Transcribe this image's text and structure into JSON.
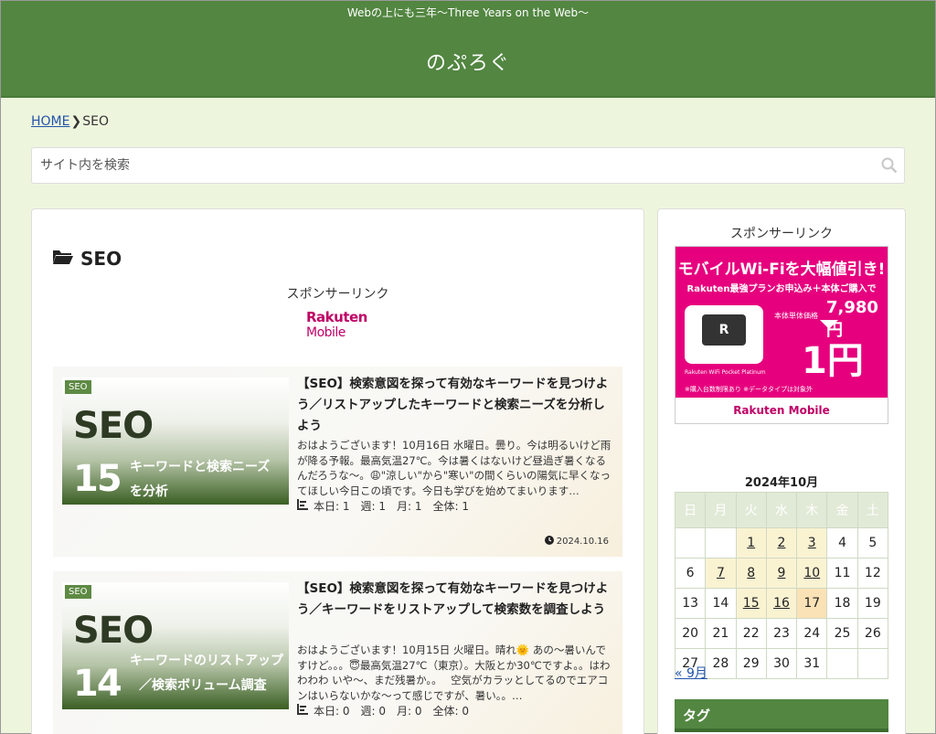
{
  "site": {
    "tagline": "Webの上にも三年〜Three Years on the Web〜",
    "title": "のぷろぐ"
  },
  "breadcrumb": {
    "home": "HOME",
    "current": "SEO"
  },
  "search": {
    "placeholder": "サイト内を検索"
  },
  "category": {
    "title": "SEO"
  },
  "sponsor_label": "スポンサーリンク",
  "rakuten_logo": {
    "line1": "Rakuten",
    "line2": "Mobile"
  },
  "posts": [
    {
      "badge": "SEO",
      "thumb_big": "SEO",
      "thumb_num": "15",
      "thumb_line1": "キーワードと検索ニーズ",
      "thumb_line2": "を分析",
      "title": "【SEO】検索意図を探って有効なキーワードを見つけよう／リストアップしたキーワードと検索ニーズを分析しよう",
      "excerpt": "おはようございます！10月16日 水曜日。曇り。今は明るいけど雨が降る予報。最高気温27℃。今は暑くはないけど昼過ぎ暑くなるんだろうな〜。😩\"涼しい\"から\"寒い\"の間くらいの陽気に早くなってほしい今日この頃です。今日も学びを始めてまいります…",
      "stats": "本日: 1　週: 1　月: 1　全体: 1",
      "date": "2024.10.16"
    },
    {
      "badge": "SEO",
      "thumb_big": "SEO",
      "thumb_num": "14",
      "thumb_line1": "キーワードのリストアップ",
      "thumb_line2": "／検索ボリューム調査",
      "title": "【SEO】検索意図を探って有効なキーワードを見つけよう／キーワードをリストアップして検索数を調査しよう",
      "excerpt": "おはようございます！10月15日 火曜日。晴れ🌞 あの〜暑いんですけど。。。😇最高気温27℃（東京）。大阪とか30℃ですよ。。はわわわわ いや〜、まだ残暑か。。　 空気がカラッとしてるのでエアコンはいらないかな〜って感じですが、暑い。。…",
      "stats": "本日: 0　週: 0　月: 0　全体: 0",
      "date": ""
    }
  ],
  "ad": {
    "headline": "モバイルWi-Fiを大幅値引き!",
    "sub": "Rakuten最強プランお申込み＋本体ご購入で",
    "price_label": "本体単体価格",
    "price": "7,980円",
    "deal": "1円",
    "device_name": "Rakuten WiFi Pocket Platinum",
    "note": "※購入台数制限あり ※データタイプは対象外",
    "device_mark": "R",
    "footer": "Rakuten Mobile"
  },
  "calendar": {
    "title": "2024年10月",
    "weekdays": [
      "日",
      "月",
      "火",
      "水",
      "木",
      "金",
      "土"
    ],
    "prev": "« 9月"
  },
  "tags_heading": "タグ",
  "colors": {
    "header": "#528641",
    "background": "#eef5dd",
    "accent_pink": "#e6007e"
  }
}
